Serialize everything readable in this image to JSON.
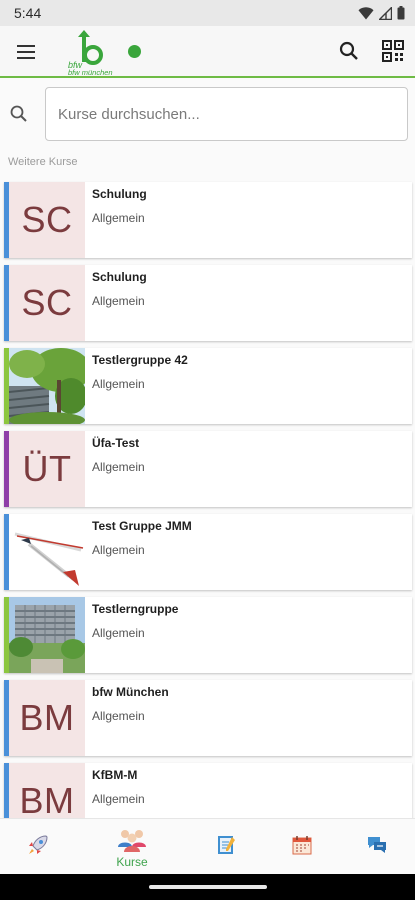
{
  "status_bar": {
    "time": "5:44"
  },
  "app_bar": {
    "logo_text": "bfw münchen"
  },
  "search": {
    "placeholder": "Kurse durchsuchen..."
  },
  "section_label": "Weitere Kurse",
  "courses": [
    {
      "title": "Schulung",
      "subtitle": "Allgemein",
      "thumb_text": "SC",
      "thumb": "initials",
      "accent": "#4a90d9"
    },
    {
      "title": "Schulung",
      "subtitle": "Allgemein",
      "thumb_text": "SC",
      "thumb": "initials",
      "accent": "#4a90d9"
    },
    {
      "title": "Testlergruppe 42",
      "subtitle": "Allgemein",
      "thumb": "tree-photo",
      "accent": "#8cc63f"
    },
    {
      "title": "Üfa-Test",
      "subtitle": "Allgemein",
      "thumb_text": "ÜT",
      "thumb": "initials",
      "accent": "#8e3fa8"
    },
    {
      "title": "Test Gruppe JMM",
      "subtitle": "Allgemein",
      "thumb": "glider-photo",
      "accent": "#4a90d9"
    },
    {
      "title": "Testlerngruppe",
      "subtitle": "Allgemein",
      "thumb": "building-photo",
      "accent": "#8cc63f"
    },
    {
      "title": "bfw München",
      "subtitle": "Allgemein",
      "thumb_text": "BM",
      "thumb": "initials",
      "accent": "#4a90d9"
    },
    {
      "title": "KfBM-M",
      "subtitle": "Allgemein",
      "thumb_text": "BM",
      "thumb": "initials",
      "accent": "#4a90d9"
    }
  ],
  "bottom_nav": [
    {
      "icon": "rocket-icon",
      "label": ""
    },
    {
      "icon": "people-icon",
      "label": "Kurse",
      "active": true
    },
    {
      "icon": "notebook-icon",
      "label": ""
    },
    {
      "icon": "calendar-icon",
      "label": ""
    },
    {
      "icon": "chat-icon",
      "label": ""
    }
  ],
  "colors": {
    "brand_green": "#6ebb45",
    "active_nav": "#3fa34d",
    "initials_bg": "#f4e5e5",
    "initials_text": "#7b3b3e"
  }
}
